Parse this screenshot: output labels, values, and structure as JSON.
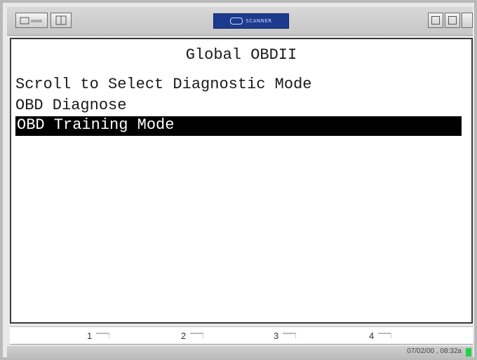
{
  "toolbar": {
    "left_button_1_icon": "folder-icon",
    "left_button_2_icon": "grid-icon",
    "brand_text": "SCANNER",
    "right_buttons": [
      "window-icon",
      "print-icon",
      "save-icon"
    ]
  },
  "screen": {
    "title": "Global OBDII",
    "prompt": "Scroll to Select Diagnostic Mode",
    "items": [
      {
        "label": "OBD Diagnose",
        "selected": false
      },
      {
        "label": "OBD Training Mode",
        "selected": true
      }
    ]
  },
  "softkeys": [
    "1",
    "2",
    "3",
    "4"
  ],
  "status": {
    "text": "07/02/00 , 08:32a",
    "indicator_color": "#28d04a"
  }
}
